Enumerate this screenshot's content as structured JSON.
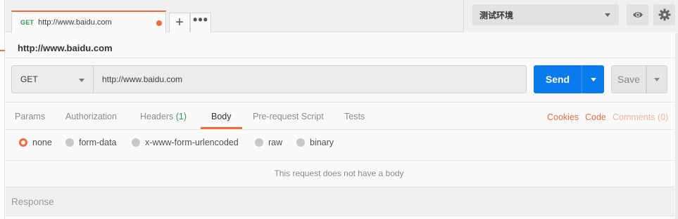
{
  "tab": {
    "method": "GET",
    "url": "http://www.baidu.com",
    "unsaved": true
  },
  "tab_actions": {
    "new_tab": "+",
    "more": "•••"
  },
  "environment": {
    "selected": "测试环境"
  },
  "request": {
    "title": "http://www.baidu.com",
    "method": "GET",
    "url": "http://www.baidu.com",
    "send_label": "Send",
    "save_label": "Save"
  },
  "subtabs": [
    {
      "label": "Params"
    },
    {
      "label": "Authorization"
    },
    {
      "label": "Headers ",
      "count": "(1)"
    },
    {
      "label": "Body",
      "active": true
    },
    {
      "label": "Pre-request Script"
    },
    {
      "label": "Tests"
    }
  ],
  "links": {
    "cookies": "Cookies",
    "code": "Code",
    "comments": "Comments (0)"
  },
  "body_modes": [
    {
      "label": "none",
      "checked": true
    },
    {
      "label": "form-data"
    },
    {
      "label": "x-www-form-urlencoded"
    },
    {
      "label": "raw"
    },
    {
      "label": "binary"
    }
  ],
  "body_message": "This request does not have a body",
  "response": {
    "label": "Response"
  },
  "colors": {
    "accent": "#f26b3a",
    "send": "#097bed",
    "method_get": "#2f9e4f"
  }
}
